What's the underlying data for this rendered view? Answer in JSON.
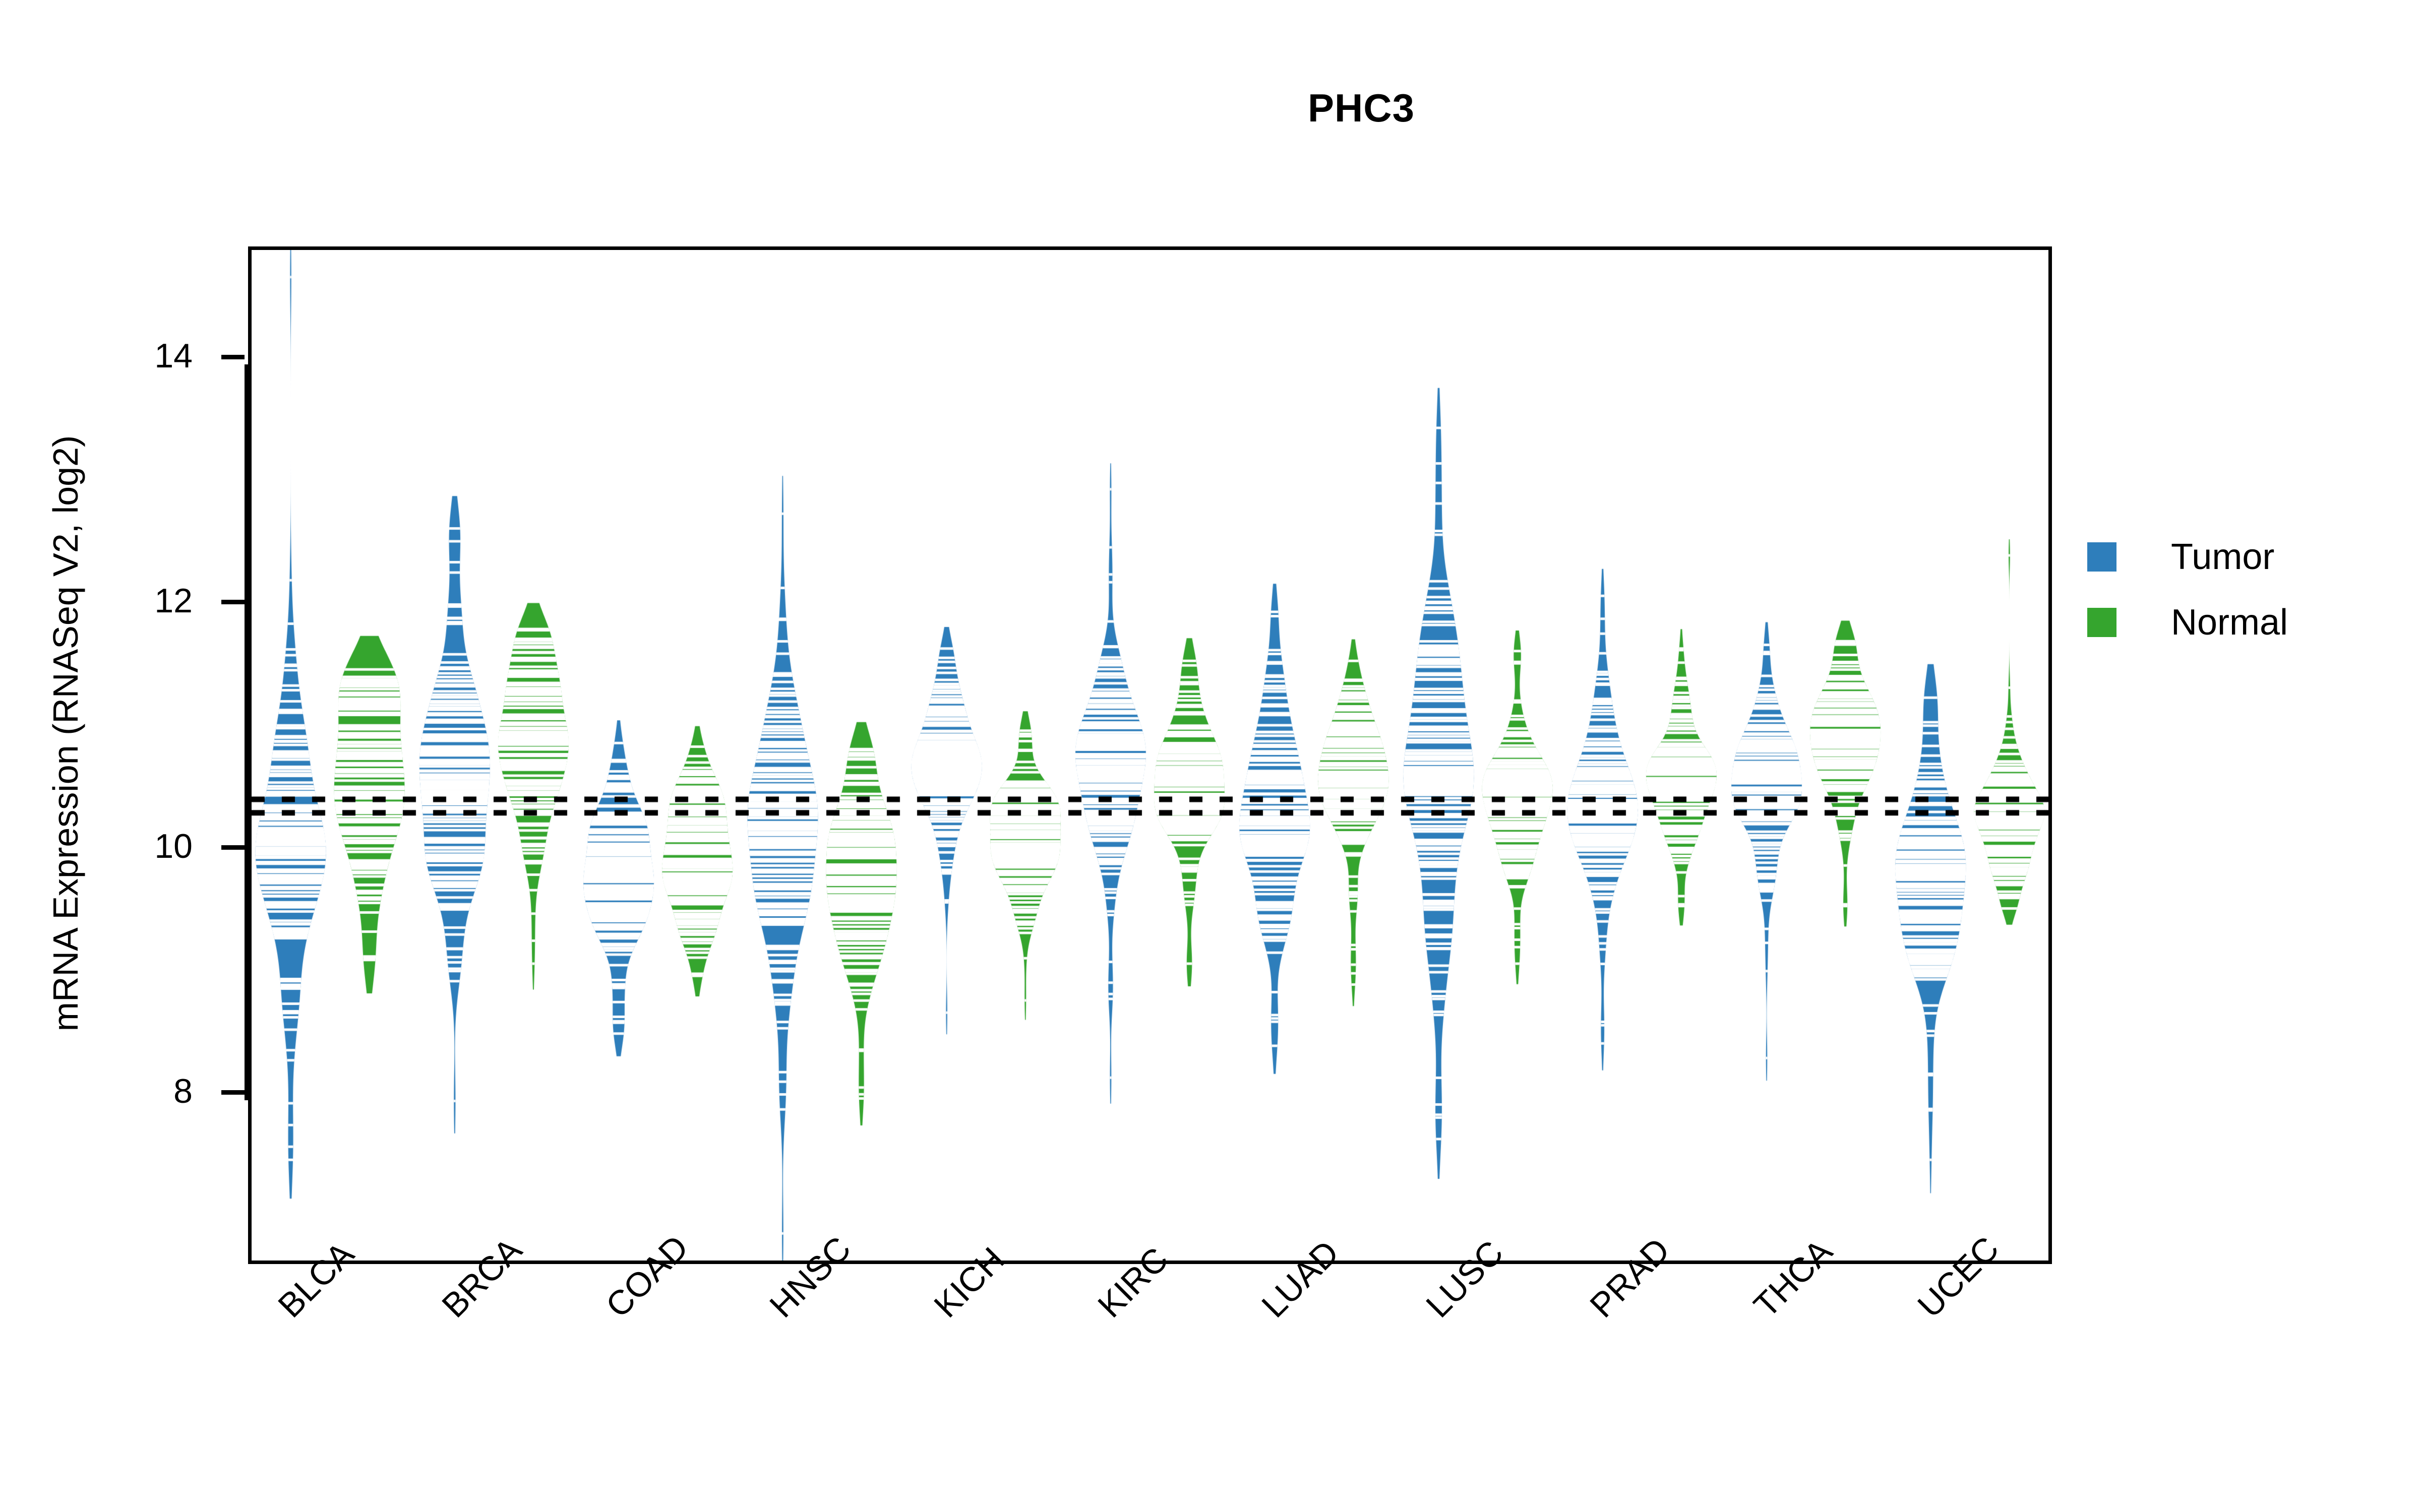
{
  "chart_data": {
    "type": "bar",
    "plot_style": "beanplot",
    "title": "PHC3",
    "xlabel": "",
    "ylabel": "mRNA Expression (RNASeq V2, log2)",
    "ylim": [
      6.6,
      14.9
    ],
    "yticks": [
      8,
      10,
      12,
      14
    ],
    "ytick_labels": [
      "8",
      "10",
      "12",
      "14"
    ],
    "grid": false,
    "legend_position": "right",
    "categories": [
      "BLCA",
      "BRCA",
      "COAD",
      "HNSC",
      "KICH",
      "KIRC",
      "LUAD",
      "LUSC",
      "PRAD",
      "THCA",
      "UCEC"
    ],
    "legend": [
      "Tumor",
      "Normal"
    ],
    "colors": {
      "tumor": "#2E7EBB",
      "normal": "#35A52E",
      "reference_line": "#000000",
      "axis": "#000000"
    },
    "reference_lines": [
      10.39,
      10.28
    ],
    "series": [
      {
        "name": "Tumor",
        "color": "#2E7EBB",
        "medians": [
          10.12,
          10.5,
          9.82,
          10.05,
          10.7,
          10.6,
          10.22,
          10.62,
          10.33,
          10.56,
          9.78
        ],
        "values": [
          {
            "category": "BLCA",
            "median": 10.12,
            "min": 7.45,
            "max": 14.65,
            "q1": 9.55,
            "q3": 10.45,
            "density_peak": 10.05,
            "spread": 0.72
          },
          {
            "category": "BRCA",
            "median": 10.5,
            "min": 7.93,
            "max": 12.6,
            "q1": 10.05,
            "q3": 10.9,
            "density_peak": 10.45,
            "spread": 0.6
          },
          {
            "category": "COAD",
            "median": 9.82,
            "min": 8.48,
            "max": 10.85,
            "q1": 9.5,
            "q3": 10.15,
            "density_peak": 9.82,
            "spread": 0.42
          },
          {
            "category": "HNSC",
            "median": 10.05,
            "min": 6.85,
            "max": 12.72,
            "q1": 9.55,
            "q3": 10.55,
            "density_peak": 10.15,
            "spread": 0.7
          },
          {
            "category": "KICH",
            "median": 10.7,
            "min": 8.65,
            "max": 11.62,
            "q1": 10.35,
            "q3": 10.95,
            "density_peak": 10.72,
            "spread": 0.4
          },
          {
            "category": "KIRC",
            "median": 10.6,
            "min": 8.12,
            "max": 12.92,
            "q1": 10.15,
            "q3": 10.95,
            "density_peak": 10.62,
            "spread": 0.48
          },
          {
            "category": "LUAD",
            "median": 10.22,
            "min": 8.38,
            "max": 11.92,
            "q1": 9.78,
            "q3": 10.58,
            "density_peak": 10.22,
            "spread": 0.52
          },
          {
            "category": "LUSC",
            "median": 10.62,
            "min": 7.62,
            "max": 13.42,
            "q1": 10.18,
            "q3": 11.32,
            "density_peak": 10.58,
            "spread": 0.74
          },
          {
            "category": "PRAD",
            "median": 10.33,
            "min": 8.4,
            "max": 12.05,
            "q1": 9.95,
            "q3": 10.72,
            "density_peak": 10.35,
            "spread": 0.5
          },
          {
            "category": "THCA",
            "median": 10.56,
            "min": 8.28,
            "max": 11.65,
            "q1": 10.18,
            "q3": 10.88,
            "density_peak": 10.58,
            "spread": 0.42
          },
          {
            "category": "UCEC",
            "median": 9.78,
            "min": 7.45,
            "max": 11.22,
            "q1": 9.42,
            "q3": 10.3,
            "density_peak": 9.7,
            "spread": 0.62
          }
        ]
      },
      {
        "name": "Normal",
        "color": "#35A52E",
        "medians": [
          9.85,
          10.9,
          9.88,
          9.82,
          10.1,
          10.55,
          10.55,
          10.32,
          10.48,
          10.85,
          10.22
        ],
        "values": [
          {
            "category": "BLCA",
            "median": 9.85,
            "min": 9.08,
            "max": 11.45,
            "q1": 9.62,
            "q3": 10.78,
            "density_peak": 10.7,
            "spread": 0.62
          },
          {
            "category": "BRCA",
            "median": 10.9,
            "min": 9.05,
            "max": 11.78,
            "q1": 10.55,
            "q3": 11.15,
            "density_peak": 10.92,
            "spread": 0.48
          },
          {
            "category": "COAD",
            "median": 9.88,
            "min": 8.95,
            "max": 10.82,
            "q1": 9.6,
            "q3": 10.12,
            "density_peak": 9.9,
            "spread": 0.38
          },
          {
            "category": "HNSC",
            "median": 9.82,
            "min": 7.95,
            "max": 10.8,
            "q1": 9.42,
            "q3": 10.12,
            "density_peak": 9.85,
            "spread": 0.5
          },
          {
            "category": "KICH",
            "median": 10.1,
            "min": 8.75,
            "max": 10.95,
            "q1": 9.82,
            "q3": 10.38,
            "density_peak": 10.1,
            "spread": 0.36
          },
          {
            "category": "KIRC",
            "median": 10.55,
            "min": 9.05,
            "max": 11.52,
            "q1": 10.18,
            "q3": 10.85,
            "density_peak": 10.58,
            "spread": 0.42
          },
          {
            "category": "LUAD",
            "median": 10.55,
            "min": 8.88,
            "max": 11.52,
            "q1": 10.28,
            "q3": 10.8,
            "density_peak": 10.58,
            "spread": 0.4
          },
          {
            "category": "LUSC",
            "median": 10.32,
            "min": 9.05,
            "max": 11.6,
            "q1": 10.1,
            "q3": 10.58,
            "density_peak": 10.32,
            "spread": 0.38
          },
          {
            "category": "PRAD",
            "median": 10.48,
            "min": 9.52,
            "max": 11.62,
            "q1": 10.25,
            "q3": 10.85,
            "density_peak": 10.52,
            "spread": 0.36
          },
          {
            "category": "THCA",
            "median": 10.85,
            "min": 9.52,
            "max": 11.68,
            "q1": 10.55,
            "q3": 11.05,
            "density_peak": 10.88,
            "spread": 0.38
          },
          {
            "category": "UCEC",
            "median": 10.22,
            "min": 9.5,
            "max": 12.38,
            "q1": 10.05,
            "q3": 10.45,
            "density_peak": 10.25,
            "spread": 0.3
          }
        ]
      }
    ]
  },
  "title": {
    "text": "PHC3"
  },
  "axes": {
    "y_title": "mRNA Expression (RNASeq V2, log2)",
    "y_labels": [
      "14",
      "12",
      "10",
      "8"
    ],
    "x_labels": [
      "BLCA",
      "BRCA",
      "COAD",
      "HNSC",
      "KICH",
      "KIRC",
      "LUAD",
      "LUSC",
      "PRAD",
      "THCA",
      "UCEC"
    ]
  },
  "legend": {
    "items": [
      {
        "label": "Tumor",
        "color": "#2E7EBB"
      },
      {
        "label": "Normal",
        "color": "#35A52E"
      }
    ]
  }
}
